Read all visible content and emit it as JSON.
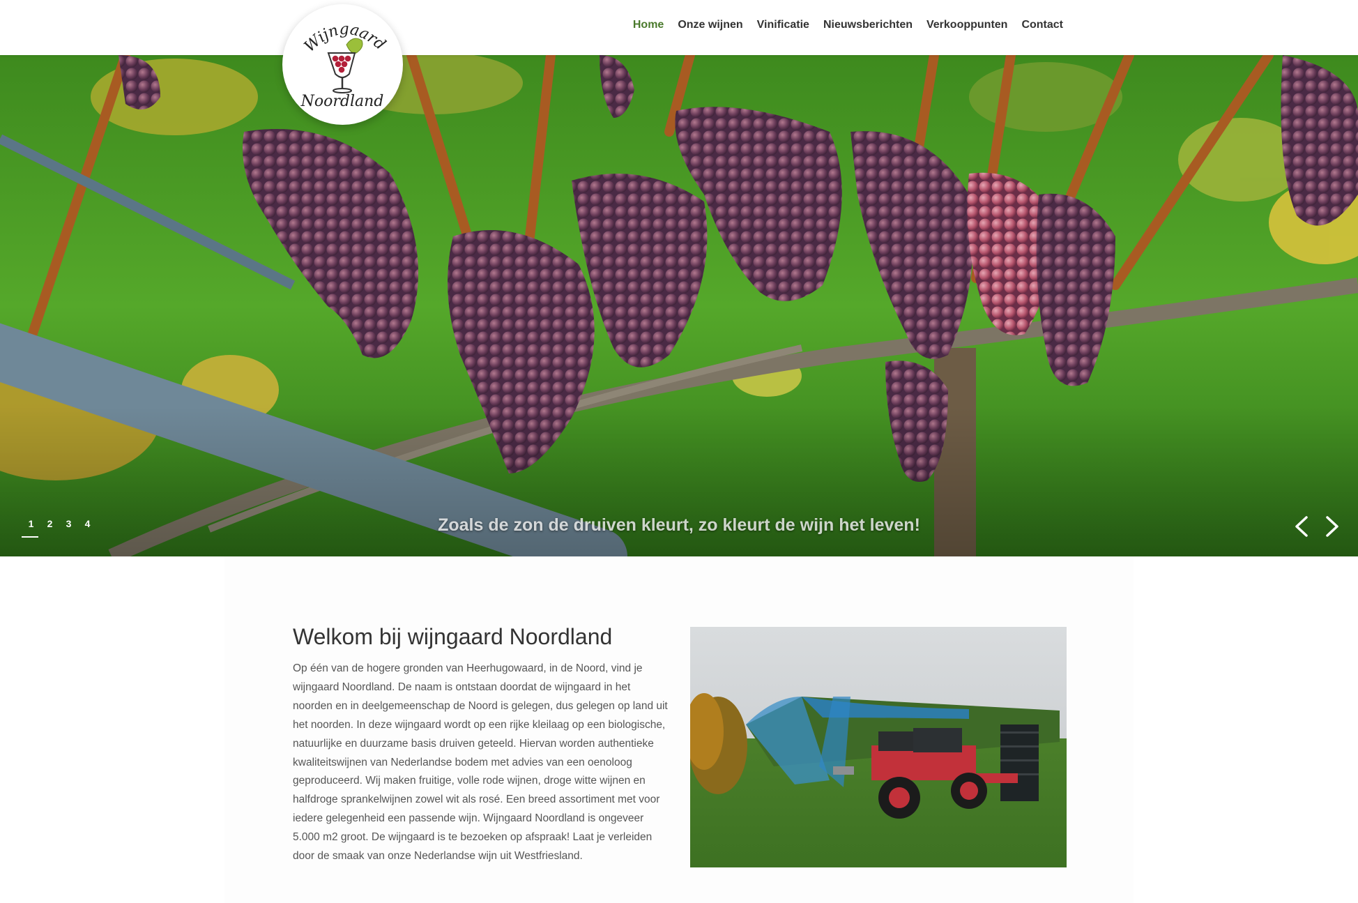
{
  "brand": {
    "logo_line1": "Wijngaard",
    "logo_line2": "Noordland"
  },
  "nav": {
    "items": [
      {
        "label": "Home",
        "active": true
      },
      {
        "label": "Onze wijnen",
        "active": false
      },
      {
        "label": "Vinificatie",
        "active": false
      },
      {
        "label": "Nieuwsberichten",
        "active": false
      },
      {
        "label": "Verkooppunten",
        "active": false
      },
      {
        "label": "Contact",
        "active": false
      }
    ],
    "active_color": "#4a7a2c"
  },
  "hero": {
    "caption": "Zoals de zon de druiven kleurt, zo kleurt de wijn het leven!",
    "slides": [
      "1",
      "2",
      "3",
      "4"
    ],
    "active_slide": 1,
    "prev_icon": "chevron-left-icon",
    "next_icon": "chevron-right-icon"
  },
  "welcome": {
    "title": "Welkom bij wijngaard Noordland",
    "body": "Op één van de hogere gronden van Heerhugowaard, in de Noord, vind je wijngaard Noordland. De naam is ontstaan doordat de wijngaard in het noorden en in deelgemeenschap de Noord is gelegen, dus gelegen op land uit het noorden. In deze wijngaard wordt op een rijke kleilaag op een biologische, natuurlijke en duurzame basis druiven geteeld. Hiervan worden authentieke kwaliteitswijnen van Nederlandse bodem met advies van een oenoloog geproduceerd. Wij maken fruitige, volle rode wijnen, droge witte wijnen en halfdroge sprankelwijnen zowel wit als rosé. Een breed assortiment met voor iedere gelegenheid een passende wijn. Wijngaard Noordland is ongeveer 5.000 m2 groot. De wijngaard is te bezoeken op afspraak! Laat je verleiden door de smaak van onze Nederlandse wijn uit Westfriesland."
  }
}
